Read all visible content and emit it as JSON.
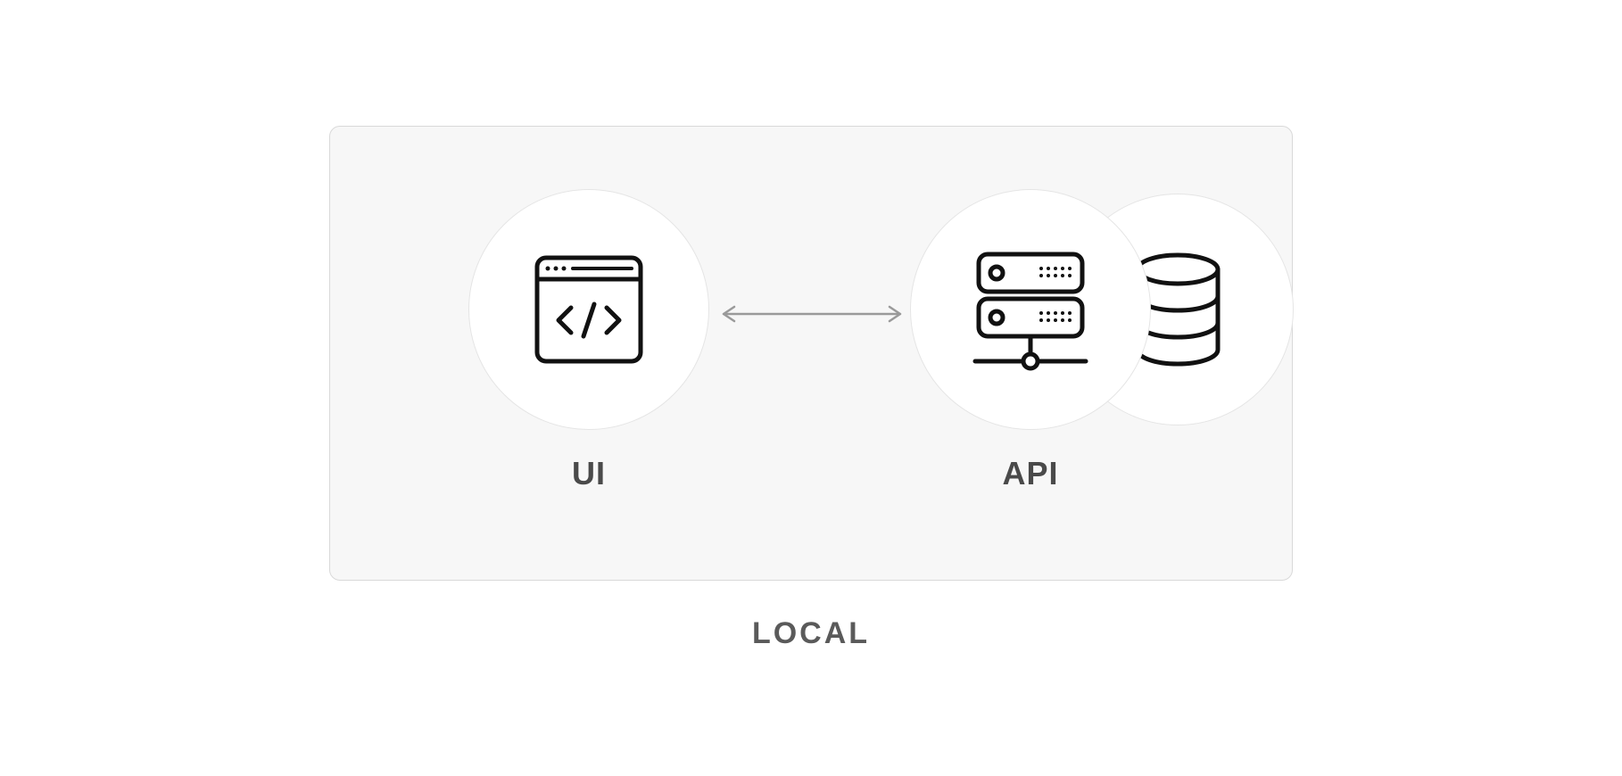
{
  "diagram": {
    "nodes": {
      "ui": {
        "label": "UI",
        "icon": "code-window-icon"
      },
      "api": {
        "label": "API",
        "icon": "server-icon"
      },
      "database": {
        "icon": "database-icon"
      }
    },
    "connection": {
      "type": "bidirectional-arrow",
      "from": "ui",
      "to": "api"
    },
    "container_label": "LOCAL"
  }
}
